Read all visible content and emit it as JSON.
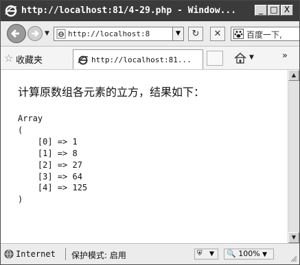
{
  "window": {
    "title": "http://localhost:81/4-29.php - Window...",
    "buttons": [
      "_",
      "□",
      "X"
    ]
  },
  "navbar": {
    "address": "http://localhost:8",
    "search_text": "百度一下,"
  },
  "favorites": {
    "label": "收藏夹",
    "tab_title": "http://localhost:81..."
  },
  "page": {
    "heading": "计算原数组各元素的立方，结果如下：",
    "output": "Array\n(\n    [0] => 1\n    [1] => 8\n    [2] => 27\n    [3] => 64\n    [4] => 125\n)"
  },
  "statusbar": {
    "zone": "Internet",
    "protected_mode": "保护模式: 启用",
    "zoom": "100%"
  },
  "icons": {
    "browser": "ie-logo-icon",
    "back": "back-arrow-icon",
    "forward": "forward-arrow-icon",
    "refresh": "refresh-icon",
    "stop": "stop-icon",
    "home": "home-icon",
    "favorites": "star-icon",
    "zone": "globe-icon"
  }
}
